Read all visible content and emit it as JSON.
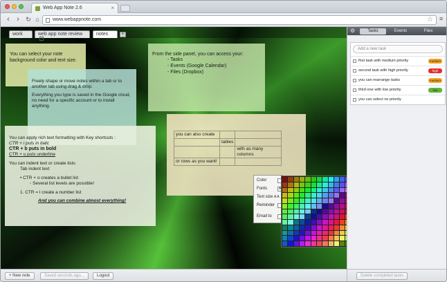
{
  "browser": {
    "tab_title": "Web App Note 2.6",
    "url": "www.webappnote.com"
  },
  "note_tabs": [
    {
      "label": "work"
    },
    {
      "label": "web app note review"
    },
    {
      "label": "notes"
    }
  ],
  "add_tab_label": "+",
  "notes": {
    "background": {
      "text": "You can select your note background color and text size."
    },
    "move": {
      "p1": "Freely shape or move notes within a tab or to another tab using drag & drop.",
      "p2": "Everything you type is saved in the Google cloud, no need for a specific account or to install anything."
    },
    "side_panel": {
      "intro": "From the side panel, you can access your:",
      "items": [
        "- Tasks",
        "- Events (Google Calendar)",
        "- Files (Dropbox)"
      ]
    },
    "formatting": {
      "intro": "You can apply rich text formatting with Key shortcuts :",
      "italic": "CTR + i puts in italic",
      "bold": "CTR + b puts in bold",
      "underline": "CTR + u puts underline",
      "lists_intro": "You can indent text or create lists:",
      "indent": "Tab indent text",
      "bullet": "CTR + o creates a bullet list",
      "sublevel": "Several list levels are possible!",
      "number": "CTR = l create a number list",
      "combine": "And you can combine almost everything!"
    },
    "table": {
      "rows": [
        [
          "you can also create",
          "",
          ""
        ],
        [
          "",
          "tables",
          ""
        ],
        [
          "",
          "",
          "with as many columns"
        ],
        [
          "or rows as you want!",
          "",
          ""
        ]
      ]
    }
  },
  "popup": {
    "color_label": "Color",
    "fonts_label": "Fonts",
    "fonts_value": "A",
    "textsize_label": "Text size",
    "textsize_value": "A A",
    "reminder_label": "Reminder",
    "email_label": "Email to"
  },
  "bottom_bar": {
    "new_note": "+ New note",
    "saved": "Saved seconds ago...",
    "logout": "Logout"
  },
  "side": {
    "tabs": [
      "Tasks",
      "Events",
      "Files"
    ],
    "new_task_placeholder": "Add a new task",
    "tasks": [
      {
        "text": "first task with medium priority",
        "priority": "medium",
        "color": "#f5a623"
      },
      {
        "text": "second task with high priority",
        "priority": "high",
        "color": "#e3302f"
      },
      {
        "text": "you can rearrange tasks",
        "priority": "medium",
        "color": "#f5a623"
      },
      {
        "text": "third one with low priority",
        "priority": "low",
        "color": "#5fb53c"
      },
      {
        "text": "you can select no priority",
        "priority": "",
        "color": ""
      }
    ],
    "delete_completed": "Delete completed tasks"
  }
}
